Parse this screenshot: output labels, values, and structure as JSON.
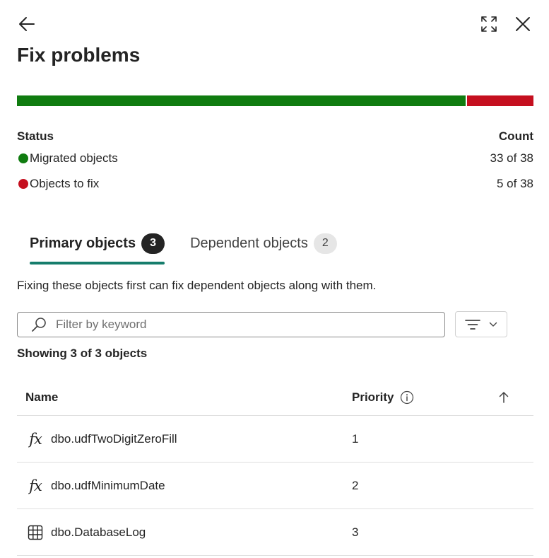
{
  "header": {
    "title": "Fix problems",
    "back_icon": "arrow-left-icon",
    "expand_icon": "expand-icon",
    "close_icon": "close-icon"
  },
  "status_bar": {
    "migrated_fraction": 0.868,
    "ok_color": "#107c10",
    "problem_color": "#c50f1f"
  },
  "status": {
    "col_status": "Status",
    "col_count": "Count",
    "rows": [
      {
        "label": "Migrated objects",
        "count": "33 of 38",
        "color": "#107c10"
      },
      {
        "label": "Objects to fix",
        "count": "5 of 38",
        "color": "#c50f1f"
      }
    ]
  },
  "tabs": [
    {
      "label": "Primary objects",
      "badge": "3",
      "active": true
    },
    {
      "label": "Dependent objects",
      "badge": "2",
      "active": false
    }
  ],
  "description": "Fixing these objects first can fix dependent objects along with them.",
  "search": {
    "placeholder": "Filter by keyword",
    "value": ""
  },
  "showing": "Showing 3 of 3 objects",
  "grid": {
    "col_name": "Name",
    "col_priority": "Priority",
    "rows": [
      {
        "name": "dbo.udfTwoDigitZeroFill",
        "priority": "1",
        "icon": "function-icon"
      },
      {
        "name": "dbo.udfMinimumDate",
        "priority": "2",
        "icon": "function-icon"
      },
      {
        "name": "dbo.DatabaseLog",
        "priority": "3",
        "icon": "table-icon"
      }
    ]
  }
}
